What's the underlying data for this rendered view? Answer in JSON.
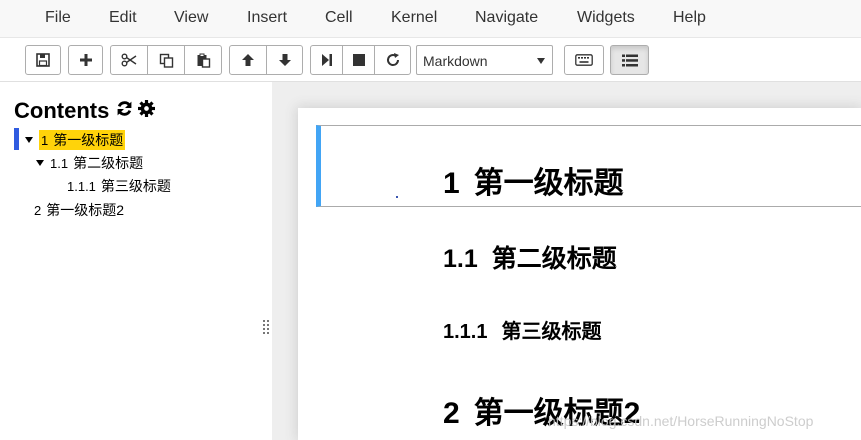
{
  "menu": [
    "File",
    "Edit",
    "View",
    "Insert",
    "Cell",
    "Kernel",
    "Navigate",
    "Widgets",
    "Help"
  ],
  "toolbar": {
    "cell_type": "Markdown"
  },
  "toc": {
    "title": "Contents",
    "items": [
      {
        "num": "1",
        "label": "第一级标题"
      },
      {
        "num": "1.1",
        "label": "第二级标题"
      },
      {
        "num": "1.1.1",
        "label": "第三级标题"
      },
      {
        "num": "2",
        "label": "第一级标题2"
      }
    ]
  },
  "notebook": {
    "headings": [
      {
        "num": "1",
        "label": "第一级标题"
      },
      {
        "num": "1.1",
        "label": "第二级标题"
      },
      {
        "num": "1.1.1",
        "label": "第三级标题"
      },
      {
        "num": "2",
        "label": "第一级标题2"
      }
    ]
  },
  "watermark": "https://blog.csdn.net/HorseRunningNoStop",
  "colors": {
    "highlight": "#ffd30a",
    "toc_active_bar": "#2f5be0",
    "cell_selected_bar": "#42a5f5"
  }
}
